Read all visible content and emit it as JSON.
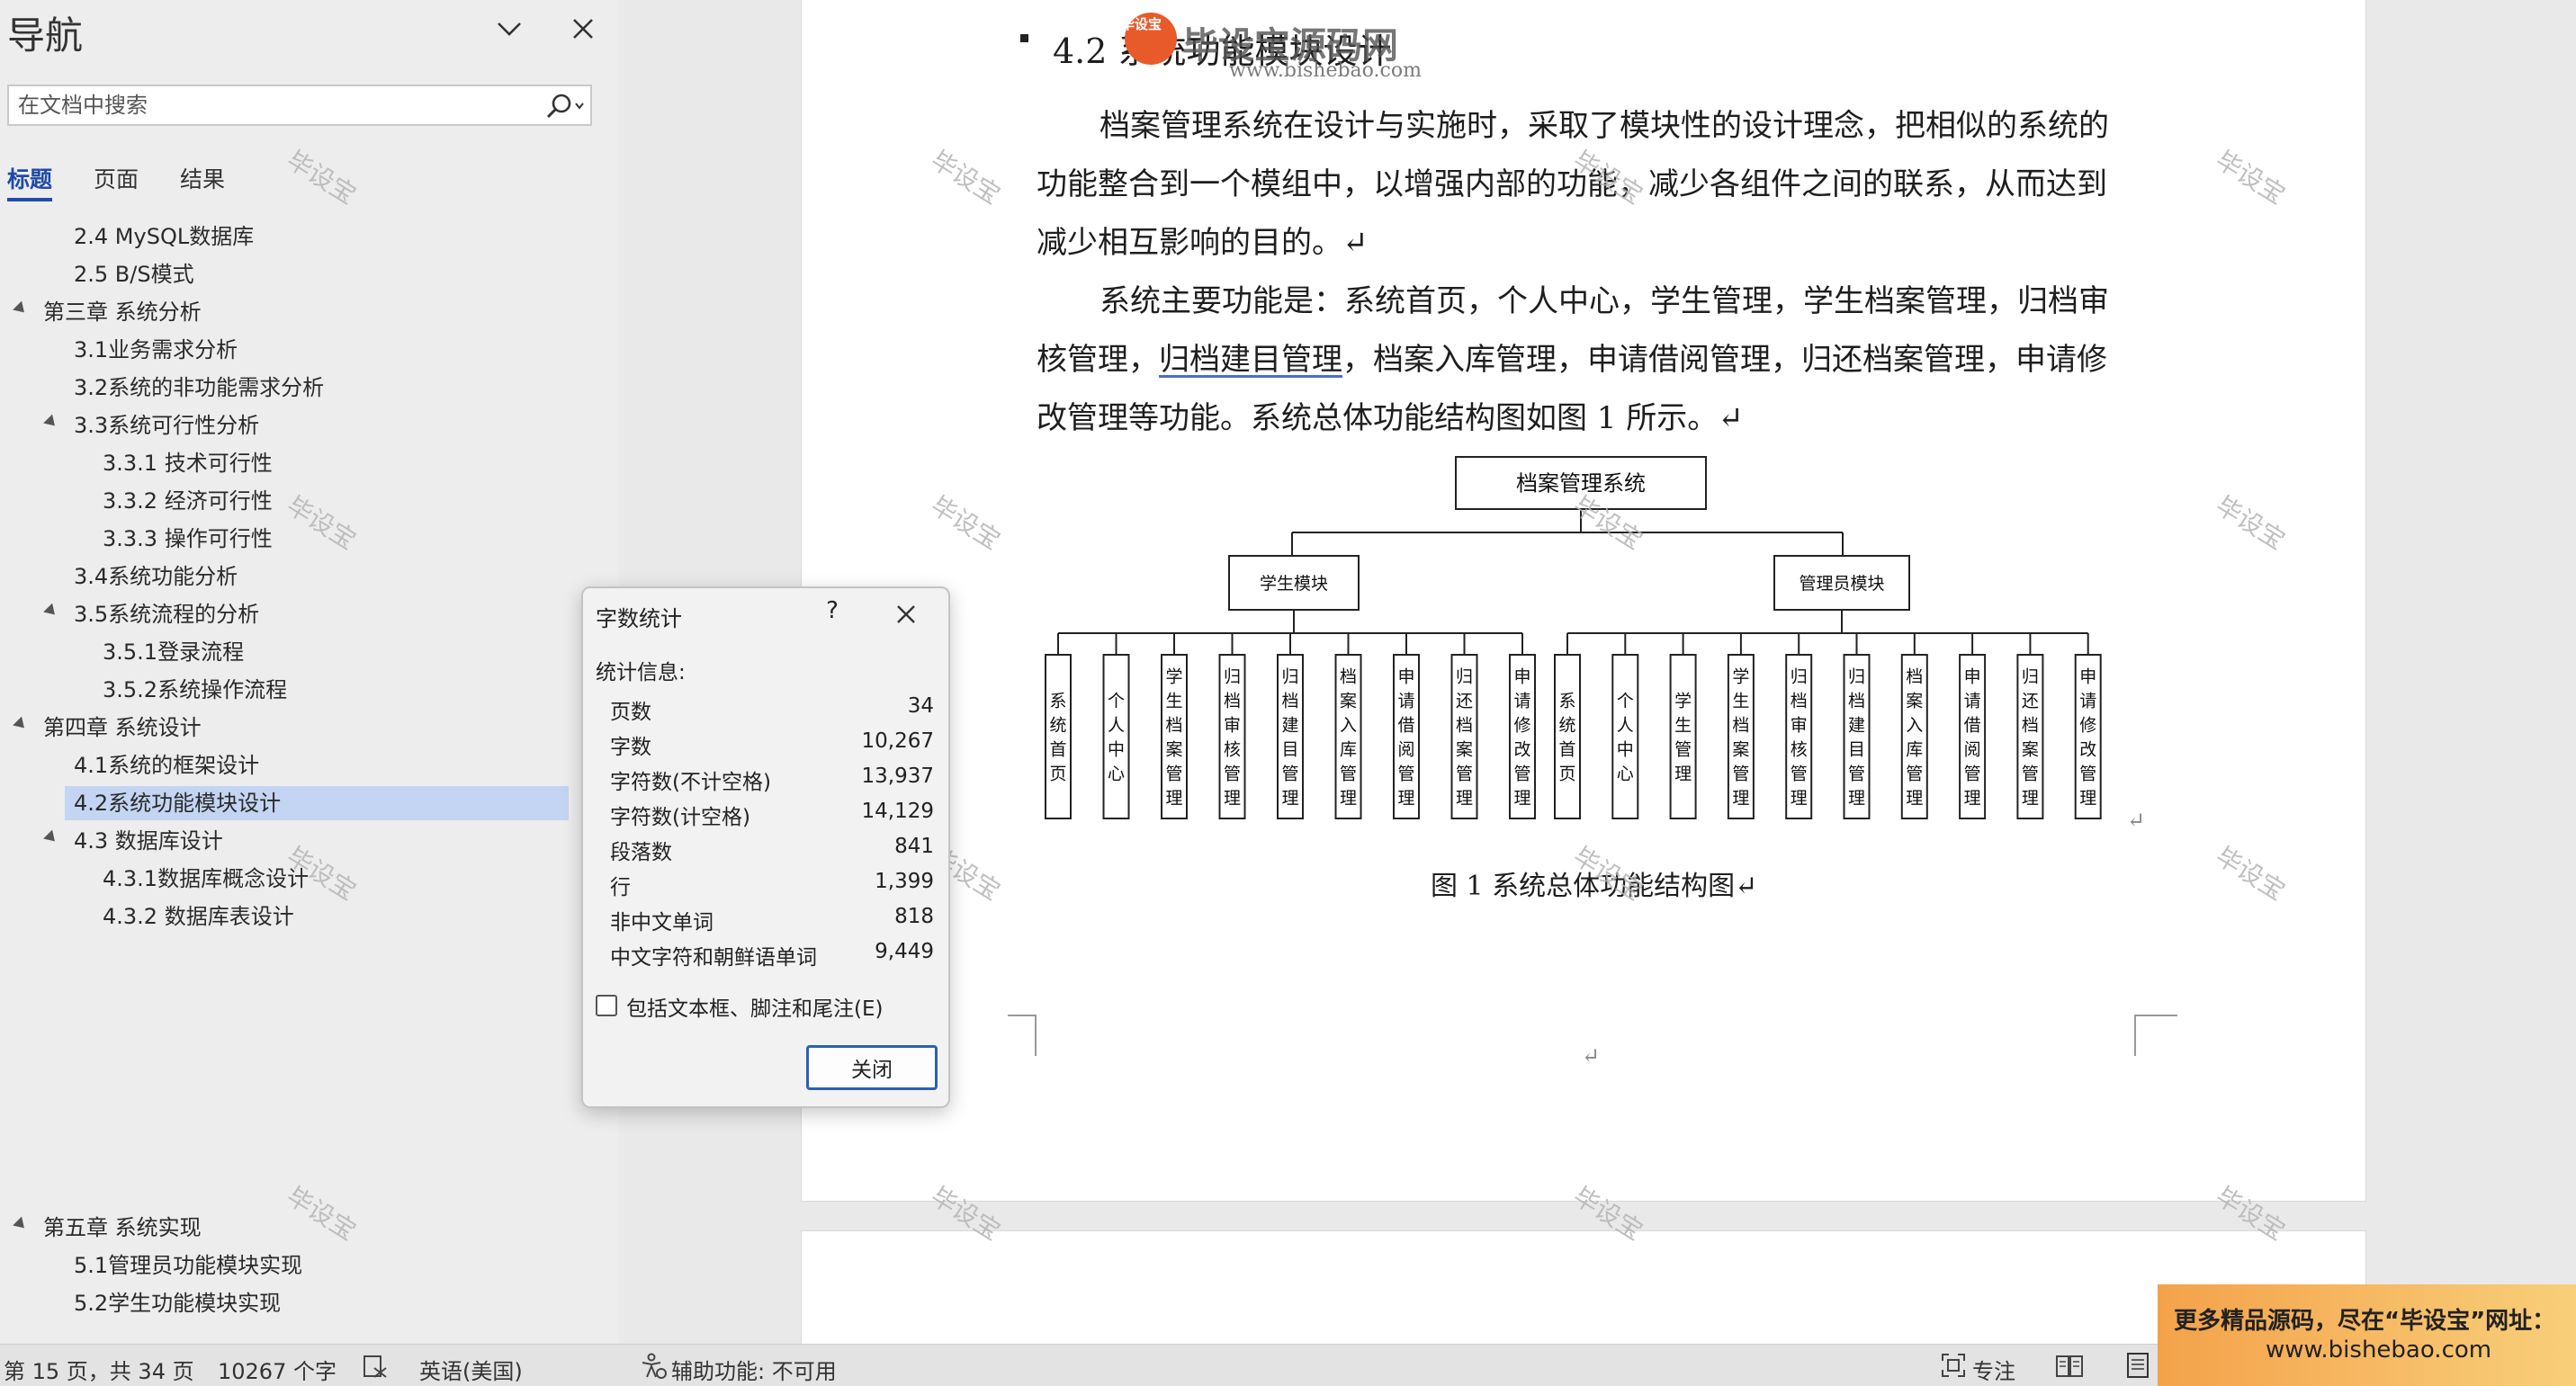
{
  "nav": {
    "title": "导航",
    "search_placeholder": "在文档中搜索",
    "tabs": [
      "标题",
      "页面",
      "结果"
    ],
    "headings": [
      "2.4 MySQL数据库",
      "2.5 B/S模式",
      "第三章 系统分析",
      "3.1业务需求分析",
      "3.2系统的非功能需求分析",
      "3.3系统可行性分析",
      "3.3.1 技术可行性",
      "3.3.2 经济可行性",
      "3.3.3 操作可行性",
      "3.4系统功能分析",
      "3.5系统流程的分析",
      "3.5.1登录流程",
      "3.5.2系统操作流程",
      "第四章 系统设计",
      "4.1系统的框架设计",
      "4.2系统功能模块设计",
      "4.3 数据库设计",
      "4.3.1数据库概念设计",
      "4.3.2 数据库表设计",
      "第五章 系统实现",
      "5.1管理员功能模块实现",
      "5.2学生功能模块实现"
    ]
  },
  "document": {
    "section_title": "4.2 系统功能模块设计",
    "para1": [
      "档案管理系统在设计与实施时，采取了模块性的设计理念，把相似的系统的",
      "功能整合到一个模组中，以增强内部的功能，减少各组件之间的联系，从而达到",
      "减少相互影响的目的。↵"
    ],
    "para2": {
      "line1": "系统主要功能是：系统首页，个人中心，学生管理，学生档案管理，归档审",
      "line2_a": "核管理，",
      "line2_link": "归档建目管理",
      "line2_b": "，档案入库管理，申请借阅管理，归还档案管理，申请修",
      "line3": "改管理等功能。系统总体功能结构图如图 1 所示。↵"
    },
    "figure_caption": "图 1  系统总体功能结构图↵",
    "para_mark": "↵"
  },
  "diagram": {
    "root": "档案管理系统",
    "student_module": "学生模块",
    "admin_module": "管理员模块",
    "student_leaves": [
      "系统首页",
      "个人中心",
      "学生档案管理",
      "归档审核管理",
      "归档建目管理",
      "档案入库管理",
      "申请借阅管理",
      "归还档案管理",
      "申请修改管理"
    ],
    "admin_leaves": [
      "系统首页",
      "个人中心",
      "学生管理",
      "学生档案管理",
      "归档审核管理",
      "归档建目管理",
      "档案入库管理",
      "申请借阅管理",
      "归还档案管理",
      "申请修改管理"
    ]
  },
  "watermark": {
    "logo_badge": "毕设宝",
    "logo_text": "毕设宝源码网",
    "logo_url": "www.bishebao.com",
    "text": "毕设宝"
  },
  "dialog": {
    "title": "字数统计",
    "help": "?",
    "stats_label": "统计信息:",
    "stats": [
      {
        "name": "页数",
        "value": "34"
      },
      {
        "name": "字数",
        "value": "10,267"
      },
      {
        "name": "字符数(不计空格)",
        "value": "13,937"
      },
      {
        "name": "字符数(计空格)",
        "value": "14,129"
      },
      {
        "name": "段落数",
        "value": "841"
      },
      {
        "name": "行",
        "value": "1,399"
      },
      {
        "name": "非中文单词",
        "value": "818"
      },
      {
        "name": "中文字符和朝鲜语单词",
        "value": "9,449"
      }
    ],
    "include_label": "包括文本框、脚注和尾注(E)",
    "include_checked": false,
    "close_label": "关闭"
  },
  "status": {
    "page": "第 15 页，共 34 页",
    "words": "10267 个字",
    "language": "英语(美国)",
    "accessibility": "辅助功能: 不可用",
    "focus": "专注"
  },
  "ad": {
    "line1": "更多精品源码，尽在“毕设宝”网址：",
    "line2": "www.bishebao.com"
  },
  "colors": {
    "accent": "#1f4aa8",
    "selected_heading": "#c3d5f2",
    "dialog_button_border": "#2d5fb4",
    "ad_orange": "#f4a24a"
  }
}
